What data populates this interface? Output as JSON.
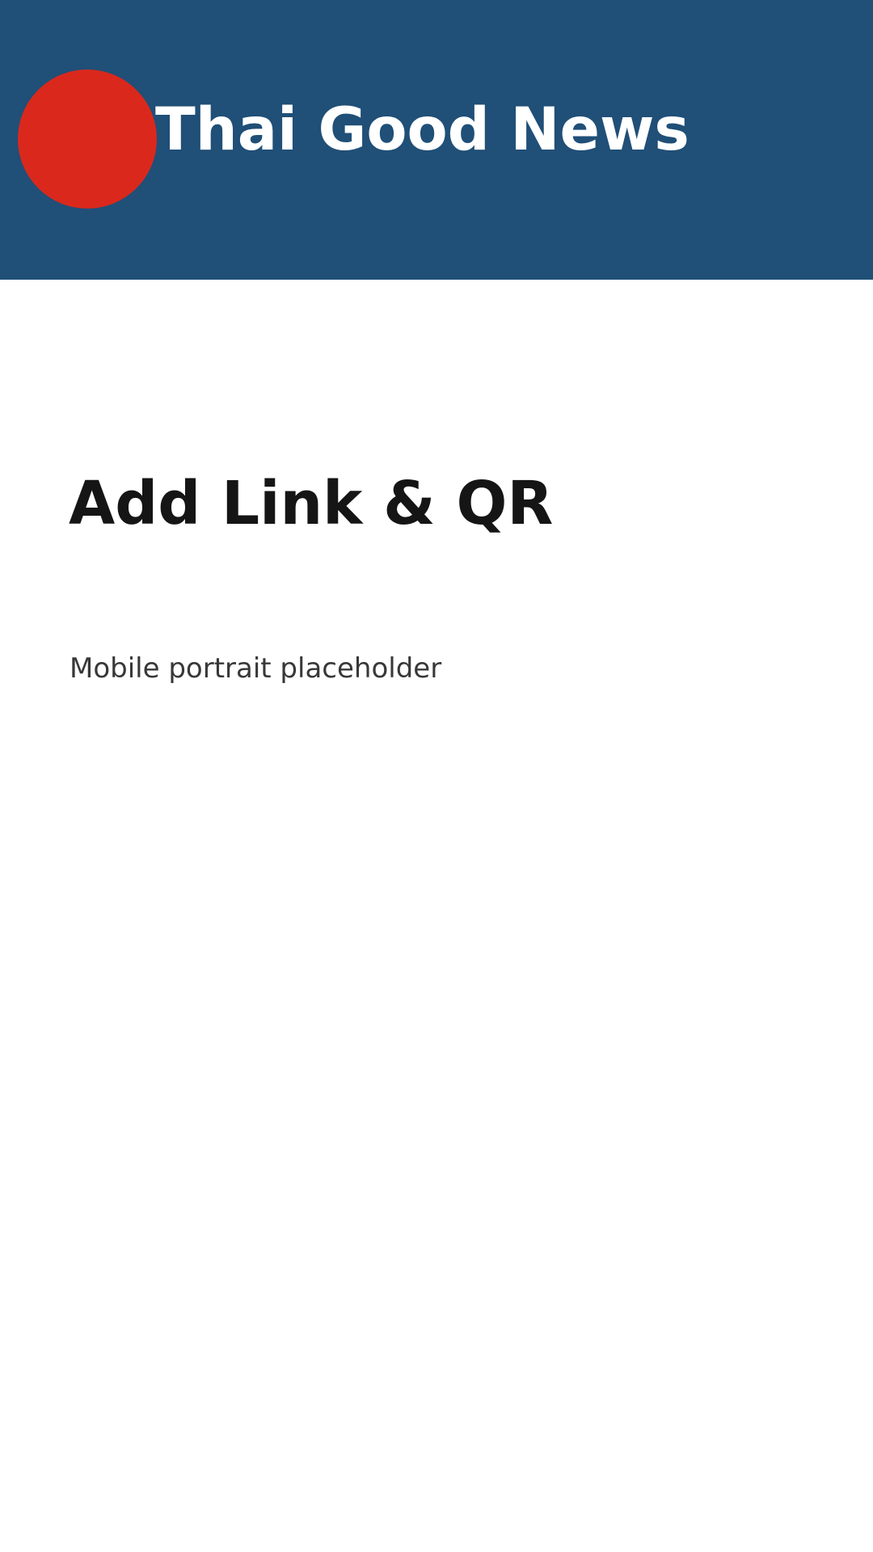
{
  "header": {
    "title": "Thai Good News",
    "logo_color": "#da291c",
    "background_color": "#204f77"
  },
  "main": {
    "title": "Add Link & QR",
    "subtitle": "Mobile portrait placeholder"
  }
}
